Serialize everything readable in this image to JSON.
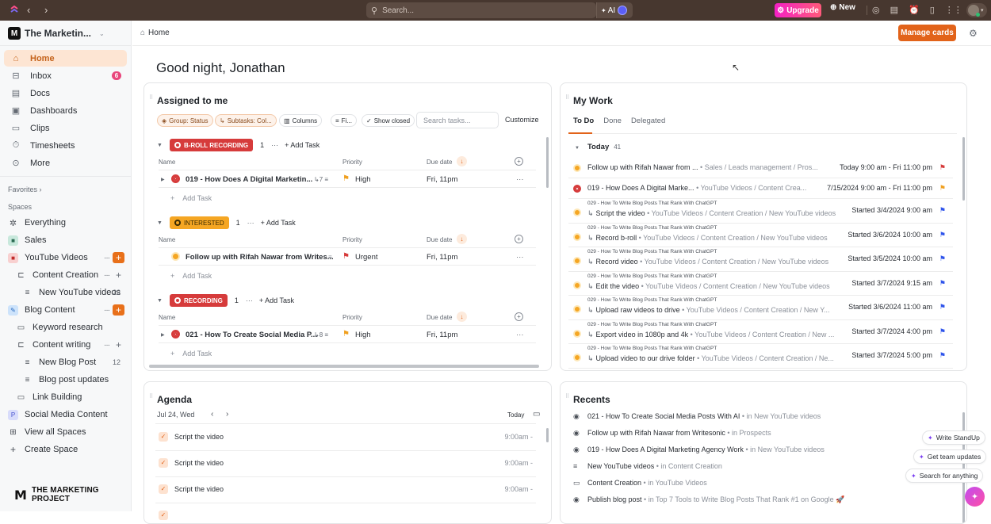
{
  "topbar": {
    "search_placeholder": "Search...",
    "ai_label": "AI",
    "upgrade_label": "Upgrade",
    "new_label": "New",
    "colors": {
      "bg": "#47372f",
      "upgrade": "#f520c4"
    }
  },
  "sidebar": {
    "workspace": "The Marketin...",
    "nav": [
      {
        "label": "Home",
        "icon": "home-icon",
        "active": true
      },
      {
        "label": "Inbox",
        "icon": "inbox-icon",
        "badge": "6"
      },
      {
        "label": "Docs",
        "icon": "doc-icon"
      },
      {
        "label": "Dashboards",
        "icon": "dashboard-icon"
      },
      {
        "label": "Clips",
        "icon": "video-icon"
      },
      {
        "label": "Timesheets",
        "icon": "timer-icon"
      },
      {
        "label": "More",
        "icon": "more-icon"
      }
    ],
    "favorites_label": "Favorites",
    "spaces_label": "Spaces",
    "spaces": [
      {
        "label": "Everything"
      },
      {
        "label": "Sales"
      },
      {
        "label": "YouTube Videos"
      },
      {
        "label": "Content Creation"
      },
      {
        "label": "New YouTube videos",
        "count": "22"
      },
      {
        "label": "Blog Content"
      },
      {
        "label": "Keyword research"
      },
      {
        "label": "Content writing"
      },
      {
        "label": "New Blog Post",
        "count": "12"
      },
      {
        "label": "Blog post updates"
      },
      {
        "label": "Link Building"
      },
      {
        "label": "Social Media Content"
      },
      {
        "label": "View all Spaces"
      },
      {
        "label": "Create Space"
      }
    ],
    "brand": "THE MARKETING PROJECT"
  },
  "header": {
    "breadcrumb": "Home",
    "manage_cards": "Manage cards",
    "greeting": "Good night, Jonathan"
  },
  "assigned": {
    "title": "Assigned to me",
    "chips": [
      "Group: Status",
      "Subtasks: Col...",
      "Columns",
      "Fi...",
      "Show closed"
    ],
    "search_placeholder": "Search tasks...",
    "customize": "Customize",
    "col_name": "Name",
    "col_priority": "Priority",
    "col_due": "Due date",
    "add_task": "Add Task",
    "groups": [
      {
        "status": "B-ROLL RECORDING",
        "color": "#d63b3b",
        "count": "1",
        "task": {
          "name": "019 - How Does A Digital Marketin...",
          "subtasks": "7",
          "priority": "High",
          "priority_color": "#f0a020",
          "due": "Fri, 11pm",
          "status_color": "#d63b3b"
        }
      },
      {
        "status": "INTERESTED",
        "color": "#f5a623",
        "count": "1",
        "task": {
          "name": "Follow up with Rifah Nawar from Writes...",
          "subtasks": "",
          "priority": "Urgent",
          "priority_color": "#d63b3b",
          "due": "Fri, 11pm",
          "status_color": "#f5a623"
        }
      },
      {
        "status": "RECORDING",
        "color": "#d63b3b",
        "count": "1",
        "task": {
          "name": "021 - How To Create Social Media P...",
          "subtasks": "8",
          "priority": "High",
          "priority_color": "#f0a020",
          "due": "Fri, 11pm",
          "status_color": "#d63b3b"
        }
      }
    ]
  },
  "mywork": {
    "title": "My Work",
    "tabs": [
      "To Do",
      "Done",
      "Delegated"
    ],
    "today_label": "Today",
    "today_count": "41",
    "items": [
      {
        "parent": "",
        "title": "Follow up with Rifah Nawar from ...",
        "path": "Sales / Leads management / Pros...",
        "date": "Today 9:00 am - Fri 11:00 pm",
        "flag": "#d63b3b",
        "status": "#f5a623",
        "sub": false
      },
      {
        "parent": "",
        "title": "019 - How Does A Digital Marke...",
        "path": "YouTube Videos / Content Crea...",
        "date": "7/15/2024 9:00 am - Fri 11:00 pm",
        "flag": "#f0a020",
        "status": "#d63b3b",
        "sub": false
      },
      {
        "parent": "029 - How To Write Blog Posts That Rank With ChatGPT",
        "title": "Script the video",
        "path": "YouTube Videos / Content Creation / New YouTube videos",
        "date": "Started 3/4/2024 9:00 am",
        "flag": "#2f54eb",
        "status": "#f5a623",
        "sub": true
      },
      {
        "parent": "029 - How To Write Blog Posts That Rank With ChatGPT",
        "title": "Record b-roll",
        "path": "YouTube Videos / Content Creation / New YouTube videos",
        "date": "Started 3/6/2024 10:00 am",
        "flag": "#2f54eb",
        "status": "#f5a623",
        "sub": true
      },
      {
        "parent": "029 - How To Write Blog Posts That Rank With ChatGPT",
        "title": "Record video",
        "path": "YouTube Videos / Content Creation / New YouTube videos",
        "date": "Started 3/5/2024 10:00 am",
        "flag": "#2f54eb",
        "status": "#f5a623",
        "sub": true
      },
      {
        "parent": "029 - How To Write Blog Posts That Rank With ChatGPT",
        "title": "Edit the video",
        "path": "YouTube Videos / Content Creation / New YouTube videos",
        "date": "Started 3/7/2024 9:15 am",
        "flag": "#2f54eb",
        "status": "#f5a623",
        "sub": true
      },
      {
        "parent": "029 - How To Write Blog Posts That Rank With ChatGPT",
        "title": "Upload raw videos to drive",
        "path": "YouTube Videos / Content Creation / New Y...",
        "date": "Started 3/6/2024 11:00 am",
        "flag": "#2f54eb",
        "status": "#f5a623",
        "sub": true
      },
      {
        "parent": "029 - How To Write Blog Posts That Rank With ChatGPT",
        "title": "Export video in 1080p and 4k",
        "path": "YouTube Videos / Content Creation / New ...",
        "date": "Started 3/7/2024 4:00 pm",
        "flag": "#2f54eb",
        "status": "#f5a623",
        "sub": true
      },
      {
        "parent": "029 - How To Write Blog Posts That Rank With ChatGPT",
        "title": "Upload video to our drive folder",
        "path": "YouTube Videos / Content Creation / Ne...",
        "date": "Started 3/7/2024 5:00 pm",
        "flag": "#2f54eb",
        "status": "#f5a623",
        "sub": true
      }
    ]
  },
  "agenda": {
    "title": "Agenda",
    "date": "Jul 24, Wed",
    "today": "Today",
    "items": [
      {
        "title": "Script the video",
        "time": "9:00am -"
      },
      {
        "title": "Script the video",
        "time": "9:00am -"
      },
      {
        "title": "Script the video",
        "time": "9:00am -"
      }
    ]
  },
  "recents": {
    "title": "Recents",
    "items": [
      {
        "icon": "task-icon",
        "title": "021 - How To Create Social Media Posts With AI",
        "location": "in New YouTube videos"
      },
      {
        "icon": "task-icon",
        "title": "Follow up with Rifah Nawar from Writesonic",
        "location": "in Prospects"
      },
      {
        "icon": "task-icon",
        "title": "019 - How Does A Digital Marketing Agency Work",
        "location": "in New YouTube videos"
      },
      {
        "icon": "list-icon",
        "title": "New YouTube videos",
        "location": "in Content Creation"
      },
      {
        "icon": "folder-icon",
        "title": "Content Creation",
        "location": "in YouTube Videos"
      },
      {
        "icon": "task-icon",
        "title": "Publish blog post",
        "location": "in Top 7 Tools to Write Blog Posts That Rank #1 on Google 🚀"
      }
    ]
  },
  "ai_assist": {
    "actions": [
      "Write StandUp",
      "Get team updates",
      "Search for anything"
    ]
  }
}
